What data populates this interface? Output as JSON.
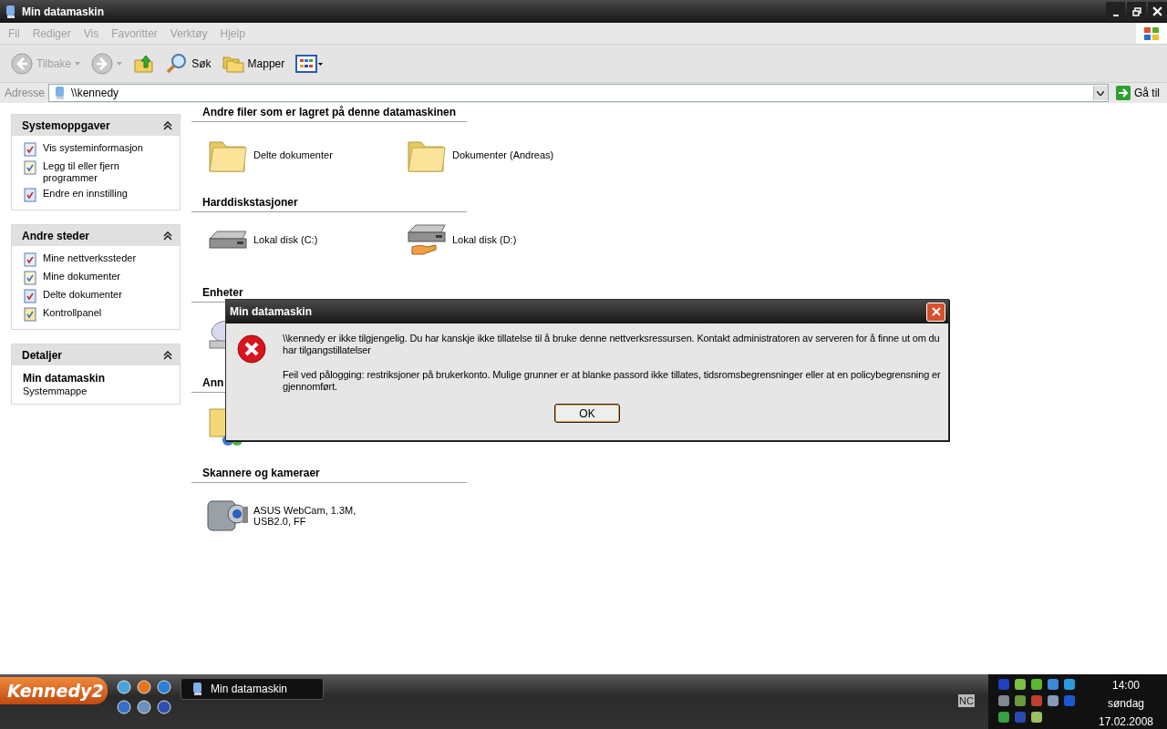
{
  "window": {
    "title": "Min datamaskin"
  },
  "menu": [
    "Fil",
    "Rediger",
    "Vis",
    "Favoritter",
    "Verktøy",
    "Hjelp"
  ],
  "toolbar": [
    {
      "kind": "back",
      "label": "Tilbake",
      "disabled": true
    },
    {
      "kind": "forward",
      "disabled": true
    },
    {
      "kind": "up"
    },
    {
      "kind": "search",
      "label": "Søk"
    },
    {
      "kind": "folders",
      "label": "Mapper"
    },
    {
      "kind": "views"
    }
  ],
  "address": {
    "label": "Adresse",
    "value": "\\\\kennedy",
    "go": "Gå til"
  },
  "sidebar": [
    {
      "title": "Systemoppgaver",
      "expanded": true,
      "items": [
        "Vis systeminformasjon",
        "Legg til eller fjern programmer",
        "Endre en innstilling"
      ]
    },
    {
      "title": "Andre steder",
      "expanded": true,
      "items": [
        "Mine nettverkssteder",
        "Mine dokumenter",
        "Delte dokumenter",
        "Kontrollpanel"
      ]
    },
    {
      "title": "Detaljer",
      "expanded": true,
      "detail_title": "Min datamaskin",
      "detail_text": "Systemmappe"
    }
  ],
  "sections": [
    {
      "heading": "Andre filer som er lagret på denne datamaskinen",
      "items": [
        {
          "kind": "folder",
          "label": "Delte dokumenter"
        },
        {
          "kind": "folder",
          "label": "Dokumenter (Andreas)"
        }
      ]
    },
    {
      "heading": "Harddiskstasjoner",
      "items": [
        {
          "kind": "disk",
          "label": "Lokal disk (C:)"
        },
        {
          "kind": "shared-disk",
          "label": "Lokal disk (D:)"
        }
      ]
    },
    {
      "heading": "Enheter",
      "items": [
        {
          "kind": "cd"
        }
      ]
    },
    {
      "heading": "Ann",
      "items": [
        {
          "kind": "shared-folder"
        }
      ]
    },
    {
      "heading": "Skannere og kameraer",
      "items": [
        {
          "kind": "camera",
          "label": "ASUS WebCam, 1.3M, USB2.0, FF"
        }
      ]
    }
  ],
  "dialog": {
    "title": "Min datamaskin",
    "messages": [
      "\\\\kennedy er ikke tilgjengelig. Du har kanskje ikke tillatelse til å bruke denne nettverksressursen. Kontakt administratoren av serveren for å finne ut om du har tilgangstillatelser",
      "Feil ved pålogging: restriksjoner på brukerkonto. Mulige grunner er at blanke passord ikke tillates, tidsromsbegrensninger eller at en policybegrensning er gjennomført."
    ],
    "button": "OK"
  },
  "taskbar": {
    "start": "Kennedy2",
    "task": "Min datamaskin",
    "indicator": "NC",
    "time": "14:00",
    "day": "søndag",
    "date": "17.02.2008"
  }
}
